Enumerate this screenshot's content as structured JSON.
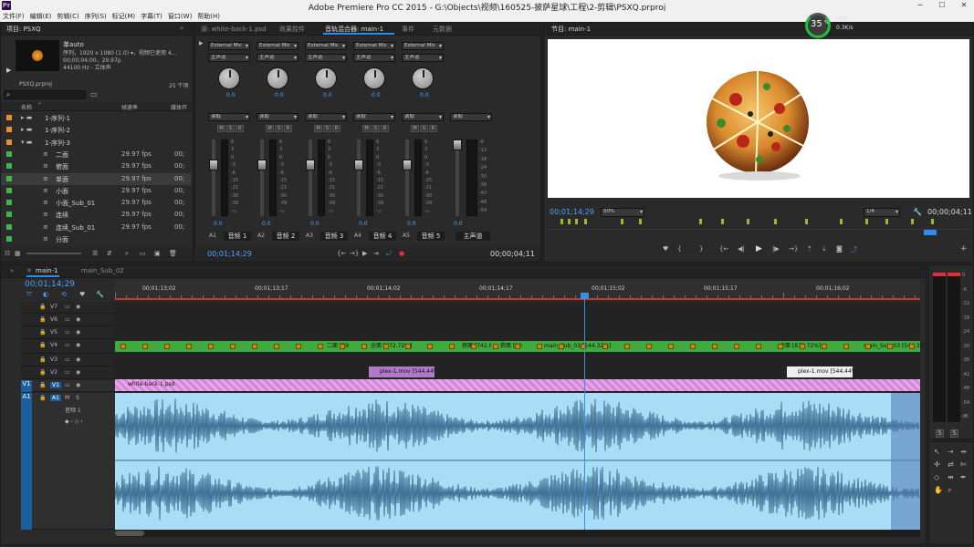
{
  "app": {
    "title": "Adobe Premiere Pro CC 2015 - G:\\Objects\\视频\\160525-披萨星球\\工程\\2-剪辑\\PSXQ.prproj",
    "icon": "Pr"
  },
  "window_controls": {
    "min": "─",
    "max": "☐",
    "close": "✕"
  },
  "menu": [
    "文件(F)",
    "编辑(E)",
    "剪辑(C)",
    "序列(S)",
    "标记(M)",
    "字幕(T)",
    "窗口(W)",
    "帮助(H)"
  ],
  "project": {
    "tab": "项目: PSXQ",
    "clip_name": "单auto",
    "info_line1": "序列，1920 x 1080 (1.0) ▾，视频已使用 4...",
    "info_line2": "00;00;04;00，29.97p",
    "info_line3": "44100 Hz - 立体声",
    "file": "PSXQ.prproj",
    "count": "25 个项",
    "col_name": "名称",
    "col_rate": "帧速率",
    "col_media": "媒体开",
    "rows": [
      {
        "name": "1-序列-1",
        "rate": "",
        "media": "",
        "type": "bin",
        "color": "#e8912b"
      },
      {
        "name": "1-序列-2",
        "rate": "",
        "media": "",
        "type": "bin",
        "color": "#e8912b"
      },
      {
        "name": "1-序列-3",
        "rate": "",
        "media": "",
        "type": "bin-open",
        "color": "#e8912b"
      },
      {
        "name": "二面",
        "rate": "29.97 fps",
        "media": "00;",
        "type": "seq",
        "color": "#3fb64a"
      },
      {
        "name": "俯面",
        "rate": "29.97 fps",
        "media": "00;",
        "type": "seq",
        "color": "#3fb64a"
      },
      {
        "name": "单面",
        "rate": "29.97 fps",
        "media": "00;",
        "type": "seq",
        "color": "#3fb64a"
      },
      {
        "name": "小面",
        "rate": "29.97 fps",
        "media": "00;",
        "type": "seq",
        "color": "#3fb64a"
      },
      {
        "name": "小面_Sub_01",
        "rate": "29.97 fps",
        "media": "00;",
        "type": "seq",
        "color": "#3fb64a"
      },
      {
        "name": "连续",
        "rate": "29.97 fps",
        "media": "00;",
        "type": "seq",
        "color": "#3fb64a"
      },
      {
        "name": "连续_Sub_01",
        "rate": "29.97 fps",
        "media": "00;",
        "type": "seq",
        "color": "#3fb64a"
      },
      {
        "name": "分面",
        "rate": "",
        "media": "",
        "type": "seq",
        "color": "#3fb64a"
      }
    ]
  },
  "mixer": {
    "tabs": [
      "源: white-back-1.psd",
      "效果控件",
      "音轨混合器: main-1",
      "事件",
      "元数据"
    ],
    "active_tab": 2,
    "channels": [
      {
        "input": "External Mic",
        "route": "主声道",
        "pan": "0.0",
        "mode": "读取",
        "gain": "0.0",
        "track": "A1",
        "name": "音频 1"
      },
      {
        "input": "External Mic",
        "route": "主声道",
        "pan": "0.0",
        "mode": "读取",
        "gain": "0.0",
        "track": "A2",
        "name": "音频 2"
      },
      {
        "input": "External Mic",
        "route": "主声道",
        "pan": "0.0",
        "mode": "读取",
        "gain": "0.0",
        "track": "A3",
        "name": "音频 3"
      },
      {
        "input": "External Mic",
        "route": "主声道",
        "pan": "0.0",
        "mode": "读取",
        "gain": "0.0",
        "track": "A4",
        "name": "音频 4"
      },
      {
        "input": "External Mic",
        "route": "主声道",
        "pan": "0.0",
        "mode": "读取",
        "gain": "0.0",
        "track": "A5",
        "name": "音频 5"
      }
    ],
    "master": {
      "mode": "读取",
      "gain": "0.0",
      "name": "主声道"
    },
    "msr": [
      "M",
      "S",
      "R"
    ],
    "scale": [
      "-6",
      "-12",
      "-18",
      "-24",
      "-30",
      "-36",
      "-42",
      "-48",
      "-54"
    ],
    "fader_scale": [
      "6",
      "3",
      "0",
      "-3",
      "-6",
      "-15",
      "-21",
      "-30",
      "-39",
      "-∞"
    ],
    "timecode": "00;01;14;29",
    "duration": "00;00;04;11"
  },
  "program": {
    "tab": "节目: main-1",
    "timecode": "00;01;14;29",
    "zoom": "50%",
    "quality": "1/4",
    "duration": "00;00;04;11"
  },
  "net_widget": {
    "cpu": "35",
    "unit": "%",
    "up": "0K/s",
    "down": "0.3K/s"
  },
  "timeline": {
    "tabs": [
      "main-1",
      "main_Sub_02"
    ],
    "timecode": "00;01;14;29",
    "ruler": [
      "00;01;13;02",
      "00;01;13;17",
      "00;01;14;02",
      "00;01;14;17",
      "00;01;15;02",
      "00;01;15;17",
      "00;01;16;02"
    ],
    "tracks": [
      "V7",
      "V6",
      "V5",
      "V4",
      "V3",
      "V2",
      "V1",
      "A1"
    ],
    "audio_track_name": "音频 1",
    "v4_clips": [
      {
        "label": "二面 [59"
      },
      {
        "label": "全面 [872.72%]"
      },
      {
        "label": "俯面 [742.85%"
      },
      {
        "label": "俯面 [10"
      },
      {
        "label": "main_Sub_03 [544.32%]"
      },
      {
        "label": "全面 [872.72%]"
      },
      {
        "label": "main_Sub_03 [544.32"
      }
    ],
    "v2_clips": [
      {
        "label": "plex-1.mov [544.44%"
      },
      {
        "label": "plex-1.mov [544.44%"
      }
    ],
    "v1_clip": "white-back-1.psd"
  },
  "meters": {
    "scale": [
      "0",
      "-6",
      "-12",
      "-18",
      "-24",
      "-30",
      "-36",
      "-42",
      "-48",
      "-54",
      "dB"
    ],
    "solo": [
      "S",
      "S"
    ]
  }
}
